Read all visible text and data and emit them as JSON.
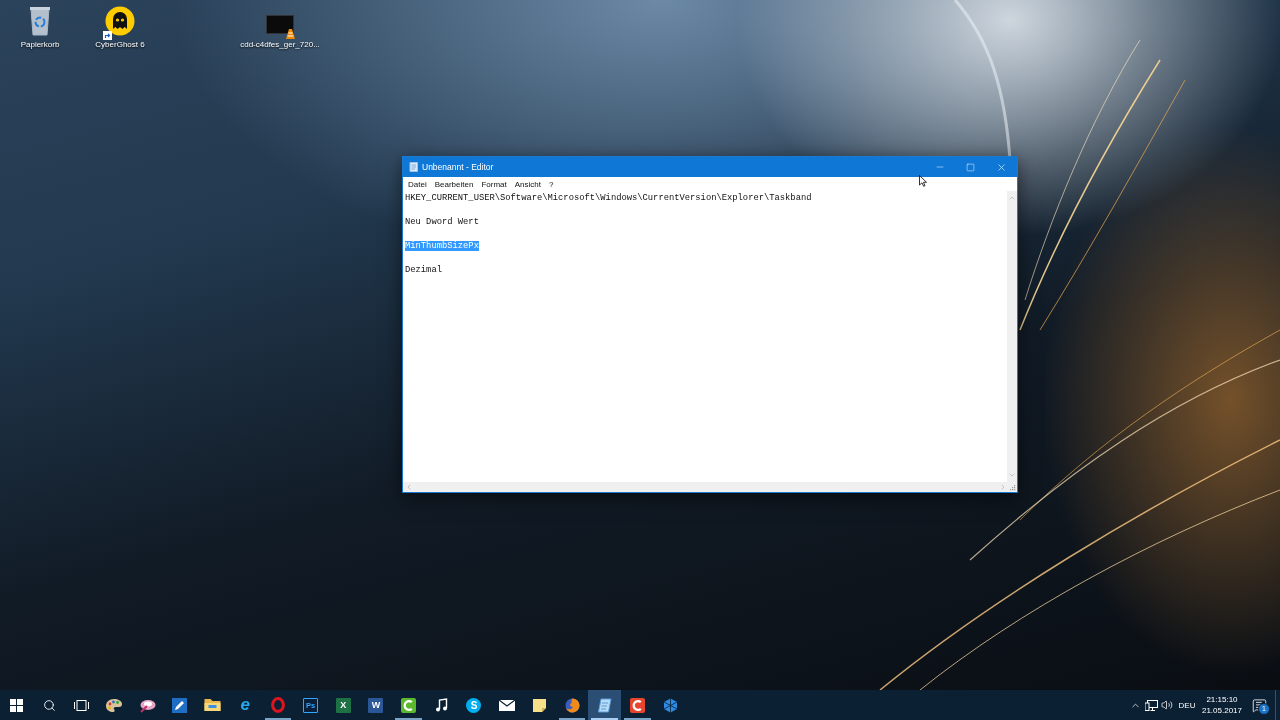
{
  "desktop_icons": [
    {
      "kind": "recycle-bin",
      "label": "Papierkorb",
      "shortcut": false
    },
    {
      "kind": "ghost",
      "label": "CyberGhost 6",
      "shortcut": true
    },
    {
      "kind": "video",
      "label": "cdd-c4dfes_ger_720...",
      "shortcut": false
    }
  ],
  "window": {
    "title": "Unbenannt - Editor",
    "menu": [
      "Datei",
      "Bearbeiten",
      "Format",
      "Ansicht",
      "?"
    ],
    "lines": [
      {
        "text": "HKEY_CURRENT_USER\\Software\\Microsoft\\Windows\\CurrentVersion\\Explorer\\Taskband",
        "selected": false
      },
      {
        "text": "Neu Dword Wert",
        "selected": false
      },
      {
        "text": "MinThumbSizePx",
        "selected": true
      },
      {
        "text": "Dezimal",
        "selected": false
      }
    ]
  },
  "taskbar": {
    "buttons": [
      {
        "kind": "start"
      },
      {
        "kind": "search"
      },
      {
        "kind": "task-view"
      }
    ],
    "apps": [
      {
        "kind": "palette",
        "running": false,
        "selected": false
      },
      {
        "kind": "splash",
        "running": false,
        "selected": false
      },
      {
        "kind": "pen",
        "running": false,
        "selected": false
      },
      {
        "kind": "folder",
        "running": false,
        "selected": false
      },
      {
        "kind": "ie",
        "glyph": "e",
        "running": false,
        "selected": false
      },
      {
        "kind": "ring",
        "running": true,
        "selected": false
      },
      {
        "kind": "ps",
        "glyph": "Ps",
        "running": false,
        "selected": false
      },
      {
        "kind": "excel",
        "glyph": "X",
        "running": false,
        "selected": false
      },
      {
        "kind": "word",
        "glyph": "W",
        "running": false,
        "selected": false
      },
      {
        "kind": "arc-green",
        "running": true,
        "selected": false
      },
      {
        "kind": "music",
        "running": false,
        "selected": false
      },
      {
        "kind": "skype",
        "glyph": "S",
        "running": false,
        "selected": false
      },
      {
        "kind": "mail",
        "running": false,
        "selected": false
      },
      {
        "kind": "sticky",
        "running": false,
        "selected": false
      },
      {
        "kind": "globe",
        "running": true,
        "selected": false
      },
      {
        "kind": "notepad",
        "running": true,
        "selected": true
      },
      {
        "kind": "arc-red",
        "running": true,
        "selected": false
      },
      {
        "kind": "cubes",
        "running": false,
        "selected": false
      }
    ],
    "tray": {
      "language": "DEU",
      "time": "21:15:10",
      "date": "21.05.2017",
      "notification_count": "1"
    }
  }
}
